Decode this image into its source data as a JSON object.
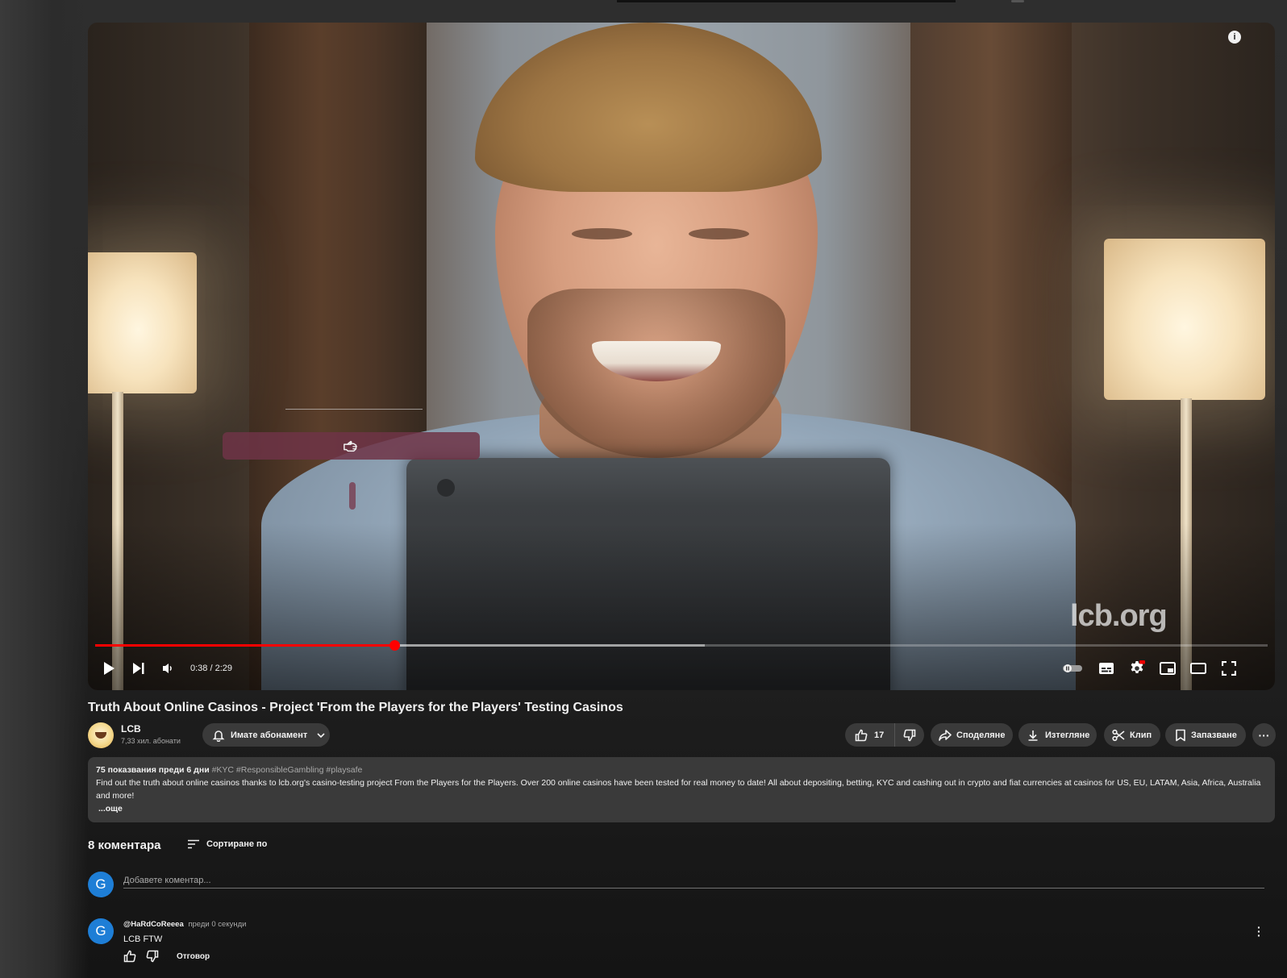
{
  "video": {
    "watermark": "lcb.org",
    "info_icon": "info-icon",
    "overlay_icon": "pointing-hand-icon",
    "time_current": "0:38",
    "time_total": "2:29",
    "time_display": "0:38 / 2:29",
    "progress_fraction": 0.255,
    "buffered_fraction": 0.52,
    "accent_color": "#ff0000"
  },
  "title": "Truth About Online Casinos - Project 'From the Players for the Players' Testing Casinos",
  "channel": {
    "name": "LCB",
    "subscribers": "7,33 хил. абонати"
  },
  "actions": {
    "subscribe_label": "Имате абонамент",
    "like_count": "17",
    "share_label": "Споделяне",
    "download_label": "Изтегляне",
    "clip_label": "Клип",
    "save_label": "Запазване",
    "more_label": "···"
  },
  "description": {
    "meta": "75 показвания  преди 6 дни",
    "tags": "#KYC #ResponsibleGambling #playsafe",
    "text": "Find out the truth about online casinos thanks to lcb.org's casino-testing project From the Players for the Players. Over 200 online casinos have been tested for real money to date! All about depositing, betting, KYC and cashing out in crypto and fiat currencies at casinos for US, EU, LATAM, Asia, Africa, Australia and more!",
    "more": "...още"
  },
  "comments": {
    "count_label": "8 коментара",
    "sort_label": "Сортиране по",
    "input_placeholder": "Добавете коментар...",
    "user_initial": "G",
    "items": [
      {
        "initial": "G",
        "author": "@HaRdCoReeea",
        "time": "преди 0 секунди",
        "text": "LCB FTW",
        "reply_label": "Отговор"
      }
    ]
  }
}
